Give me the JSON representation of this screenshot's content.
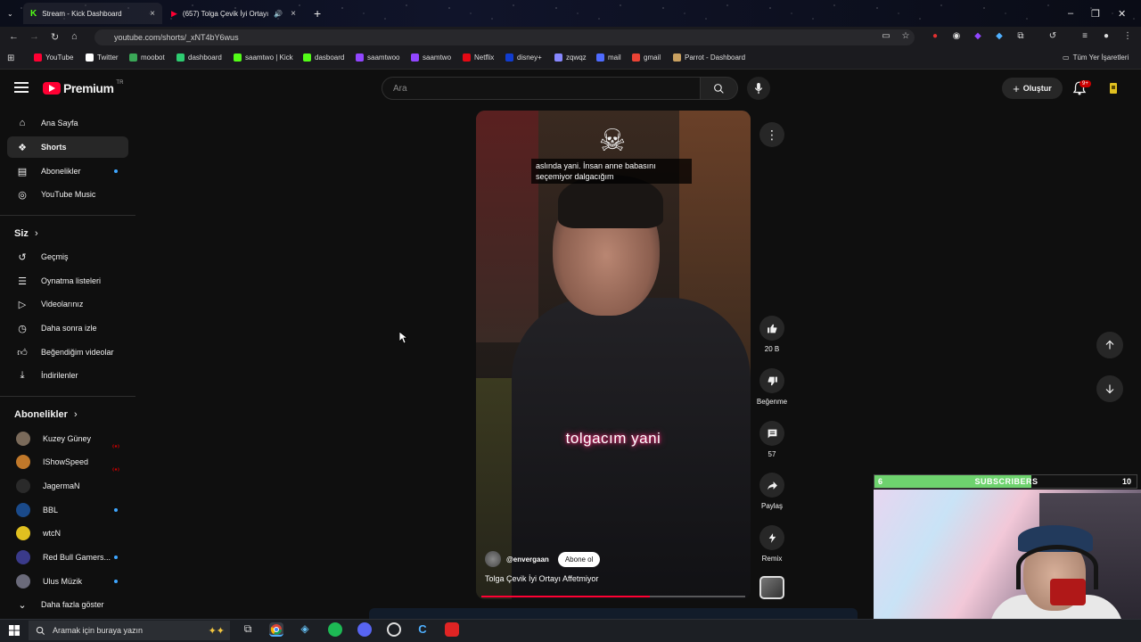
{
  "browser": {
    "tabs": [
      {
        "label": "Stream - Kick Dashboard",
        "icon": "kick-icon"
      },
      {
        "label": "(657) Tolga Çevik İyi Ortayı",
        "icon": "youtube-icon"
      }
    ],
    "url": "youtube.com/shorts/_xNT4bY6wus",
    "bookmarks": [
      {
        "label": "YouTube",
        "color": "#ff0033"
      },
      {
        "label": "Twitter",
        "color": "#ffffff"
      },
      {
        "label": "moobot",
        "color": "#3aa757"
      },
      {
        "label": "dashboard",
        "color": "#2ecc71"
      },
      {
        "label": "saamtwo | Kick",
        "color": "#53fc18"
      },
      {
        "label": "dasboard",
        "color": "#53fc18"
      },
      {
        "label": "saamtwoo",
        "color": "#9146ff"
      },
      {
        "label": "saamtwo",
        "color": "#9146ff"
      },
      {
        "label": "Netflix",
        "color": "#e50914"
      },
      {
        "label": "disney+",
        "color": "#113ccf"
      },
      {
        "label": "zqwqz",
        "color": "#8888ff"
      },
      {
        "label": "mail",
        "color": "#4f6bff"
      },
      {
        "label": "gmail",
        "color": "#ea4335"
      },
      {
        "label": "Parrot - Dashboard",
        "color": "#c8a060"
      }
    ],
    "all_bookmarks": "Tüm Yer İşaretleri"
  },
  "header": {
    "logo_text": "Premium",
    "region": "TR",
    "search_placeholder": "Ara",
    "create_label": "Oluştur",
    "notif_count": "9+"
  },
  "sidebar": {
    "main": [
      {
        "label": "Ana Sayfa",
        "icon": "home-icon"
      },
      {
        "label": "Shorts",
        "icon": "shorts-icon",
        "active": true
      },
      {
        "label": "Abonelikler",
        "icon": "subscriptions-icon"
      },
      {
        "label": "YouTube Music",
        "icon": "music-icon"
      }
    ],
    "you_heading": "Siz",
    "you": [
      {
        "label": "Geçmiş",
        "icon": "history-icon"
      },
      {
        "label": "Oynatma listeleri",
        "icon": "playlist-icon"
      },
      {
        "label": "Videolarınız",
        "icon": "your-videos-icon"
      },
      {
        "label": "Daha sonra izle",
        "icon": "watch-later-icon"
      },
      {
        "label": "Beğendiğim videolar",
        "icon": "liked-icon"
      },
      {
        "label": "İndirilenler",
        "icon": "download-icon"
      }
    ],
    "subs_heading": "Abonelikler",
    "subs": [
      {
        "label": "Kuzey Güney",
        "status": "live",
        "color": "#7a6a5a"
      },
      {
        "label": "IShowSpeed",
        "status": "live",
        "color": "#c0782a"
      },
      {
        "label": "JagermaN",
        "status": "",
        "color": "#2a2a2a"
      },
      {
        "label": "BBL",
        "status": "new",
        "color": "#1a4a8a"
      },
      {
        "label": "wtcN",
        "status": "",
        "color": "#e0c020"
      },
      {
        "label": "Red Bull Gamers...",
        "status": "new",
        "color": "#3a3a8a"
      },
      {
        "label": "Ulus Müzik",
        "status": "new",
        "color": "#6a6a7a"
      }
    ],
    "show_more": "Daha fazla göster"
  },
  "short": {
    "caption_top": "aslında yani. İnsan anne babasını seçemiyor dalgacığım",
    "caption_mid": "tolgacım yani",
    "channel": "@envergaan",
    "subscribe_label": "Abone ol",
    "title": "Tolga Çevik İyi Ortayı Affetmiyor",
    "progress": 0.64,
    "actions": {
      "like_count": "20 B",
      "dislike_label": "Beğenme",
      "comment_count": "57",
      "share_label": "Paylaş",
      "remix_label": "Remix"
    }
  },
  "overlay": {
    "sub_goal_current": "6",
    "sub_goal_title": "SUBSCRIBERS",
    "sub_goal_target": "10",
    "progress": 0.6,
    "accent": "#6ed36e"
  },
  "taskbar": {
    "search_placeholder": "Aramak için buraya yazın"
  }
}
